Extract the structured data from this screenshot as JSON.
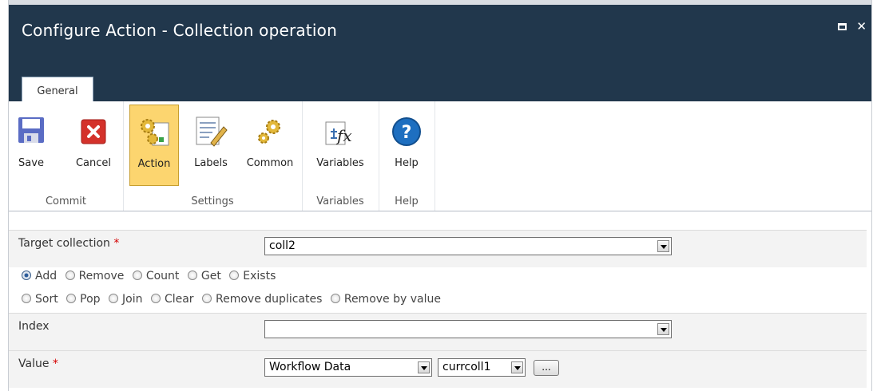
{
  "window": {
    "title": "Configure Action - Collection operation"
  },
  "tabs": [
    {
      "label": "General"
    }
  ],
  "ribbon": {
    "groups": [
      {
        "label": "Commit",
        "buttons": [
          {
            "label": "Save",
            "icon": "save-icon"
          },
          {
            "label": "Cancel",
            "icon": "cancel-icon"
          }
        ]
      },
      {
        "label": "Settings",
        "buttons": [
          {
            "label": "Action",
            "icon": "action-gears-icon",
            "active": true
          },
          {
            "label": "Labels",
            "icon": "labels-icon"
          },
          {
            "label": "Common",
            "icon": "common-gears-icon"
          }
        ]
      },
      {
        "label": "Variables",
        "buttons": [
          {
            "label": "Variables",
            "icon": "variables-fx-icon"
          }
        ]
      },
      {
        "label": "Help",
        "buttons": [
          {
            "label": "Help",
            "icon": "help-icon"
          }
        ]
      }
    ]
  },
  "form": {
    "target_collection": {
      "label": "Target collection",
      "required_mark": "*",
      "value": "coll2"
    },
    "operations_row1": [
      "Add",
      "Remove",
      "Count",
      "Get",
      "Exists"
    ],
    "operations_row2": [
      "Sort",
      "Pop",
      "Join",
      "Clear",
      "Remove duplicates",
      "Remove by value"
    ],
    "selected_operation": "Add",
    "index": {
      "label": "Index",
      "value": ""
    },
    "value": {
      "label": "Value",
      "required_mark": "*",
      "source": "Workflow Data",
      "variable": "currcoll1",
      "browse_label": "..."
    }
  },
  "colors": {
    "titlebar": "#21374c",
    "active_button": "#fcd56f",
    "required": "#d40000"
  }
}
